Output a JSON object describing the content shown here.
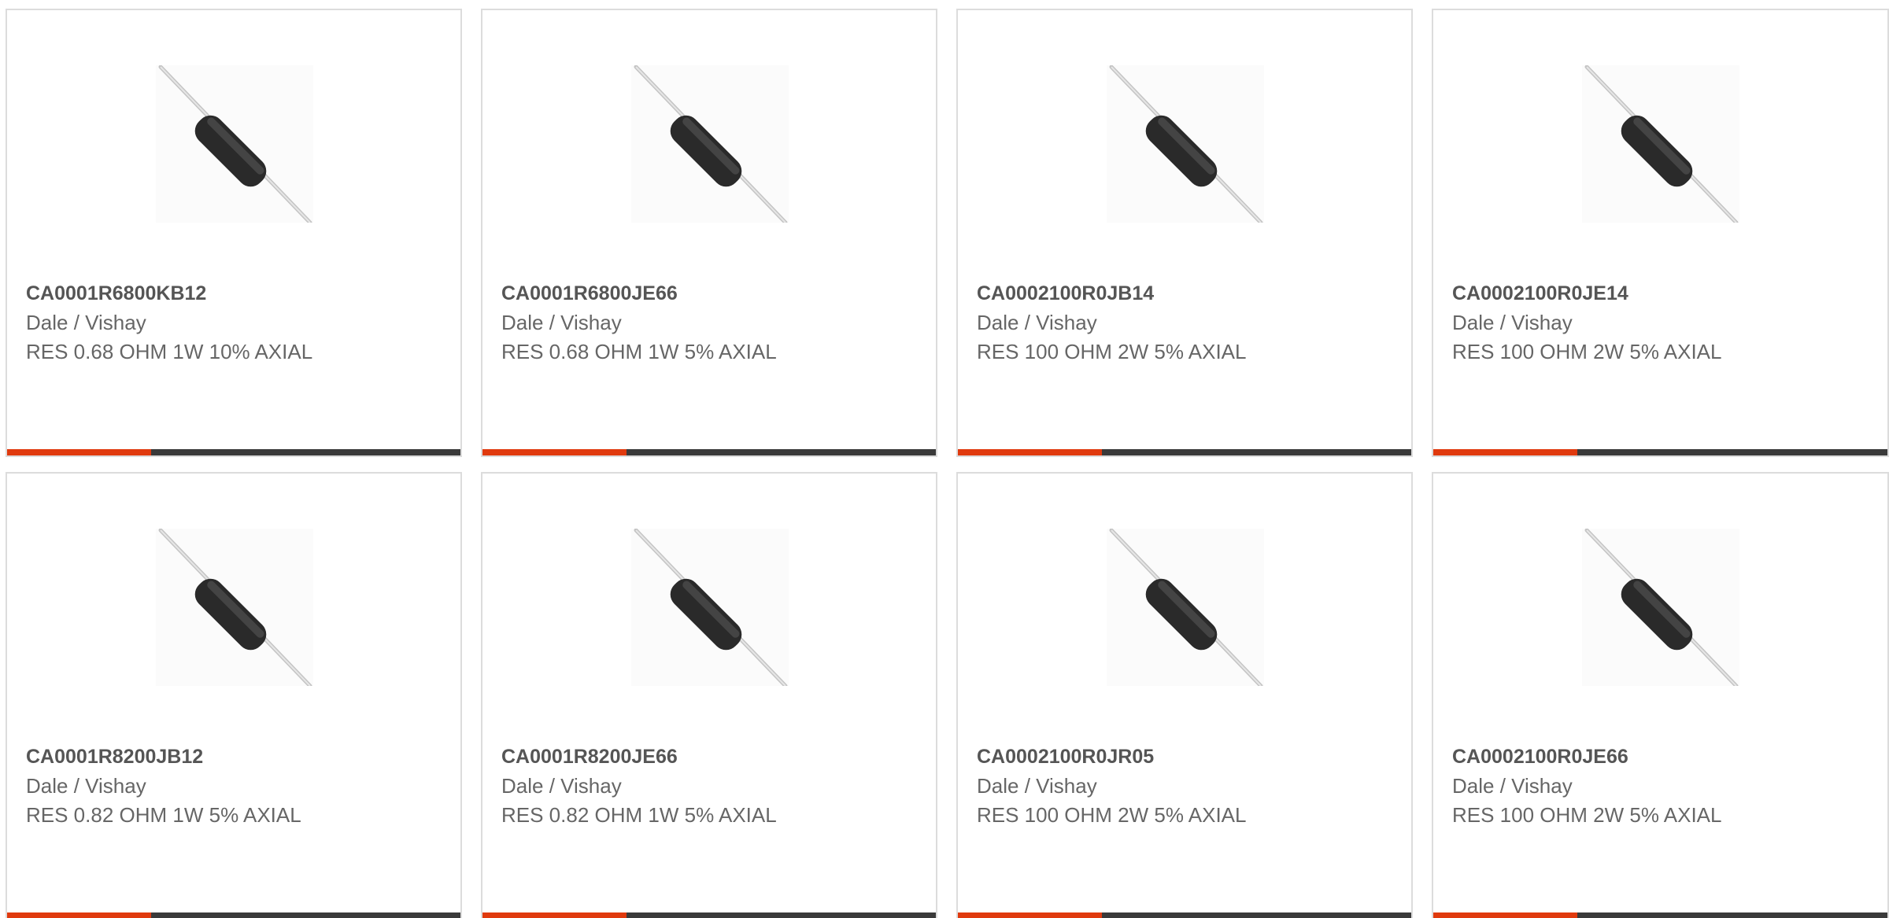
{
  "colors": {
    "accent": "#e03a0e",
    "bar": "#3a3a3a",
    "border": "#dcdcdc",
    "text": "#666666",
    "title": "#555555"
  },
  "products": [
    {
      "part_number": "CA0001R6800KB12",
      "manufacturer": "Dale / Vishay",
      "description": "RES 0.68 OHM 1W 10% AXIAL",
      "image": "axial-resistor-image"
    },
    {
      "part_number": "CA0001R6800JE66",
      "manufacturer": "Dale / Vishay",
      "description": "RES 0.68 OHM 1W 5% AXIAL",
      "image": "axial-resistor-image"
    },
    {
      "part_number": "CA0002100R0JB14",
      "manufacturer": "Dale / Vishay",
      "description": "RES 100 OHM 2W 5% AXIAL",
      "image": "axial-resistor-image"
    },
    {
      "part_number": "CA0002100R0JE14",
      "manufacturer": "Dale / Vishay",
      "description": "RES 100 OHM 2W 5% AXIAL",
      "image": "axial-resistor-image"
    },
    {
      "part_number": "CA0001R8200JB12",
      "manufacturer": "Dale / Vishay",
      "description": "RES 0.82 OHM 1W 5% AXIAL",
      "image": "axial-resistor-image"
    },
    {
      "part_number": "CA0001R8200JE66",
      "manufacturer": "Dale / Vishay",
      "description": "RES 0.82 OHM 1W 5% AXIAL",
      "image": "axial-resistor-image"
    },
    {
      "part_number": "CA0002100R0JR05",
      "manufacturer": "Dale / Vishay",
      "description": "RES 100 OHM 2W 5% AXIAL",
      "image": "axial-resistor-image"
    },
    {
      "part_number": "CA0002100R0JE66",
      "manufacturer": "Dale / Vishay",
      "description": "RES 100 OHM 2W 5% AXIAL",
      "image": "axial-resistor-image"
    }
  ]
}
